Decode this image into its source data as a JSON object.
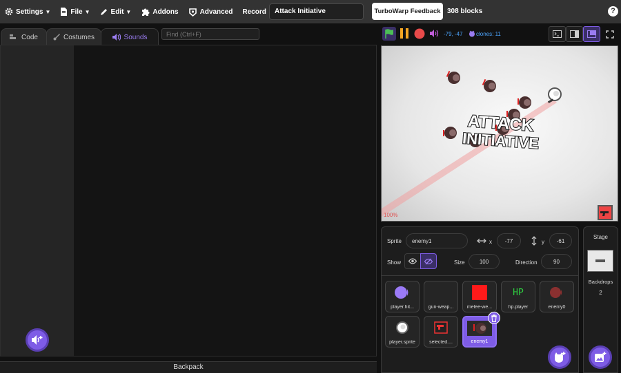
{
  "menu": {
    "settings": "Settings",
    "file": "File",
    "edit": "Edit",
    "addons": "Addons",
    "advanced": "Advanced",
    "record": "Record",
    "project_title": "Attack Initiative",
    "feedback": "TurboWarp Feedback",
    "block_count": "308 blocks",
    "help": "?"
  },
  "tabs": {
    "code": "Code",
    "costumes": "Costumes",
    "sounds": "Sounds",
    "find_placeholder": "Find (Ctrl+F)"
  },
  "backpack": "Backpack",
  "stage_bar": {
    "mouse_coords": "-79, -47",
    "clones": "clones: 11"
  },
  "stage": {
    "logo_line1": "ATTACK",
    "logo_line2": "INITIATIVE",
    "zoom": "100%"
  },
  "sprite_info": {
    "sprite_label": "Sprite",
    "sprite_name": "enemy1",
    "x_label": "x",
    "x_value": "-77",
    "y_label": "y",
    "y_value": "-61",
    "show_label": "Show",
    "size_label": "Size",
    "size_value": "100",
    "direction_label": "Direction",
    "direction_value": "90"
  },
  "sprites": [
    {
      "name": "player.hit...",
      "icon": "purple-circle"
    },
    {
      "name": "gun-weap...",
      "icon": "blank"
    },
    {
      "name": "melee-we...",
      "icon": "red-square"
    },
    {
      "name": "hp.player",
      "icon": "hp-text",
      "thumb_text": "HP"
    },
    {
      "name": "enemy0",
      "icon": "dark-red-circle"
    },
    {
      "name": "player.sprite",
      "icon": "white-circle"
    },
    {
      "name": "selected....",
      "icon": "gun-box"
    },
    {
      "name": "enemy1",
      "icon": "enemy",
      "selected": true
    }
  ],
  "stage_panel": {
    "title": "Stage",
    "backdrops_label": "Backdrops",
    "backdrops_count": "2"
  },
  "colors": {
    "accent": "#7e5ce6",
    "menubar": "#333333",
    "coord_blue": "#4da6ff",
    "stop_red": "#e84a4a",
    "pause_orange": "#f5a623",
    "flag_green": "#4cbf56"
  }
}
